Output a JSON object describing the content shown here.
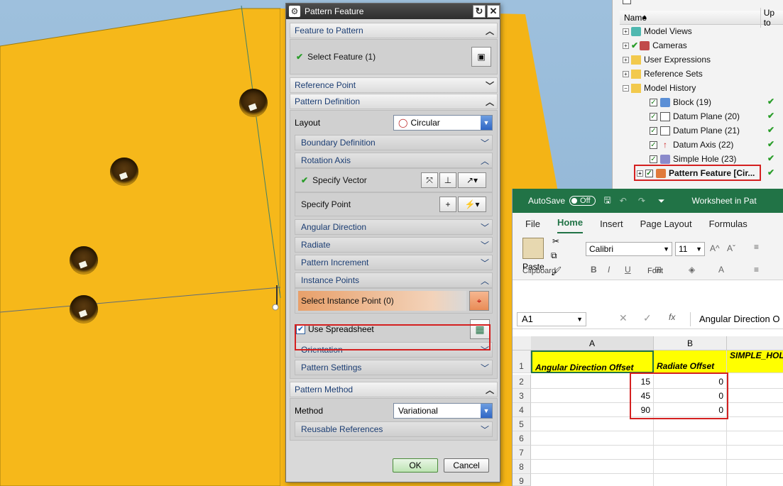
{
  "dialog": {
    "title": "Pattern Feature",
    "feature_to_pattern": "Feature to Pattern",
    "select_feature": "Select Feature (1)",
    "reference_point": "Reference Point",
    "pattern_definition": "Pattern Definition",
    "layout_label": "Layout",
    "layout_value": "Circular",
    "boundary_definition": "Boundary Definition",
    "rotation_axis": "Rotation Axis",
    "specify_vector": "Specify Vector",
    "specify_point": "Specify Point",
    "angular_direction": "Angular Direction",
    "radiate": "Radiate",
    "pattern_increment": "Pattern Increment",
    "instance_points": "Instance Points",
    "select_instance_point": "Select Instance Point (0)",
    "use_spreadsheet": "Use Spreadsheet",
    "orientation": "Orientation",
    "pattern_settings": "Pattern Settings",
    "pattern_method": "Pattern Method",
    "method_label": "Method",
    "method_value": "Variational",
    "reusable_references": "Reusable References",
    "ok": "OK",
    "cancel": "Cancel"
  },
  "navigator": {
    "col_name": "Name",
    "col_upto": "Up to",
    "items": [
      {
        "label": "Model Views"
      },
      {
        "label": "Cameras"
      },
      {
        "label": "User Expressions"
      },
      {
        "label": "Reference Sets"
      },
      {
        "label": "Model History"
      },
      {
        "label": "Block (19)"
      },
      {
        "label": "Datum Plane (20)"
      },
      {
        "label": "Datum Plane (21)"
      },
      {
        "label": "Datum Axis (22)"
      },
      {
        "label": "Simple Hole (23)"
      },
      {
        "label": "Pattern Feature [Cir..."
      }
    ]
  },
  "excel": {
    "autosave": "AutoSave",
    "toggle": "Off",
    "title": "Worksheet in Pat",
    "menu": [
      "File",
      "Home",
      "Insert",
      "Page Layout",
      "Formulas"
    ],
    "paste": "Paste",
    "clipboard": "Clipboard",
    "font_group": "Font",
    "font_name": "Calibri",
    "font_size": "11",
    "name_box": "A1",
    "formula": "Angular Direction O",
    "col_a": "A",
    "col_b": "B",
    "simple_hol": "SIMPLE_HOL",
    "hdr_a": "Angular Direction Offset",
    "hdr_b": "Radiate Offset",
    "rows": [
      {
        "n": "1"
      },
      {
        "n": "2",
        "a": "15",
        "b": "0"
      },
      {
        "n": "3",
        "a": "45",
        "b": "0"
      },
      {
        "n": "4",
        "a": "90",
        "b": "0"
      },
      {
        "n": "5"
      },
      {
        "n": "6"
      },
      {
        "n": "7"
      },
      {
        "n": "8"
      },
      {
        "n": "9"
      }
    ]
  }
}
